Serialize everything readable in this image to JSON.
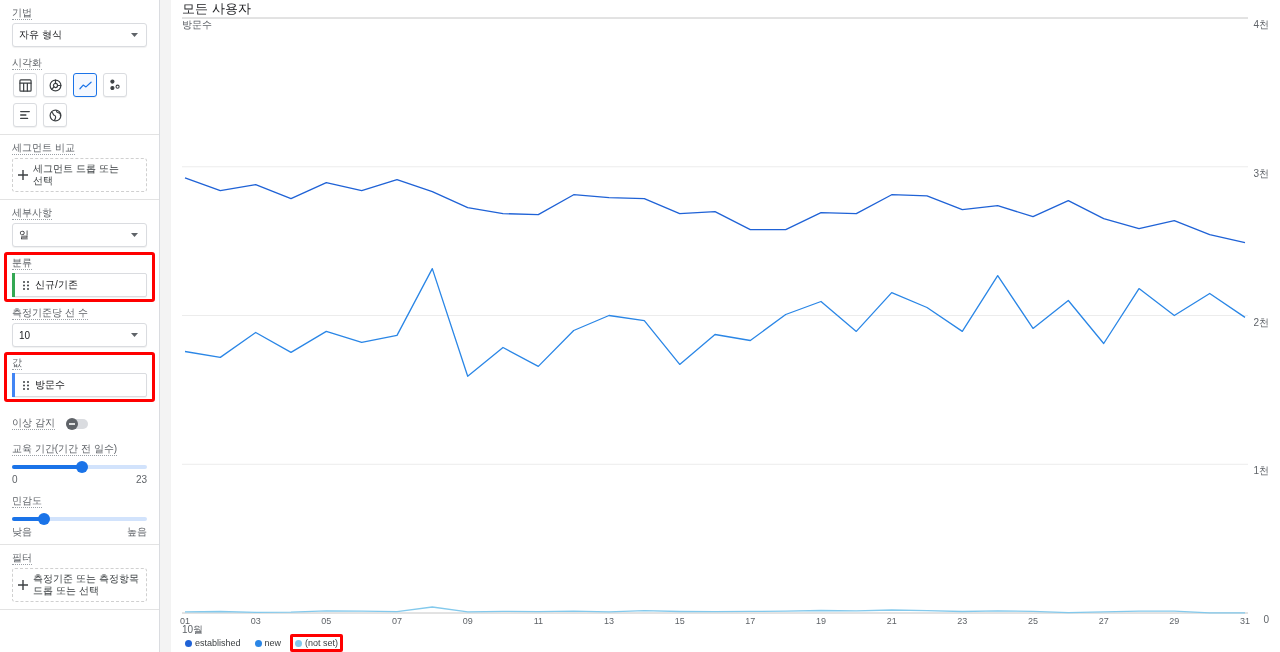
{
  "sidebar": {
    "groups": [
      {
        "fields": [
          {
            "kind": "dropdown",
            "label": "기법",
            "value": "자유 형식",
            "highlighted": false
          },
          {
            "kind": "visualizations",
            "label": "시각화",
            "highlighted": false,
            "options": [
              {
                "kind": "table",
                "selected": false
              },
              {
                "kind": "donut",
                "selected": false
              },
              {
                "kind": "line",
                "selected": true
              },
              {
                "kind": "scatter",
                "selected": false
              },
              {
                "kind": "bar",
                "selected": false
              },
              {
                "kind": "map",
                "selected": false
              }
            ]
          }
        ]
      },
      {
        "fields": [
          {
            "kind": "dropzone",
            "label": "세그먼트 비교",
            "text": "세그먼트 드롭 또는 선택",
            "highlighted": false
          }
        ]
      },
      {
        "fields": [
          {
            "kind": "dropdown",
            "label": "세부사항",
            "value": "일",
            "highlighted": false
          },
          {
            "kind": "chip",
            "label": "분류",
            "value": "신규/기존",
            "color": "#34a853",
            "highlighted": true
          },
          {
            "kind": "dropdown",
            "label": "측정기준당 선 수",
            "value": "10",
            "highlighted": false
          },
          {
            "kind": "chip",
            "label": "값",
            "value": "방문수",
            "color": "#4285f4",
            "highlighted": true
          },
          {
            "kind": "switch",
            "label": "이상 감지",
            "on": false,
            "highlighted": false
          },
          {
            "kind": "slider",
            "label": "교육 기간(기간 전 일수)",
            "level": 0.52,
            "min_label": "0",
            "max_label": "23",
            "highlighted": false
          },
          {
            "kind": "slider",
            "label": "민감도",
            "level": 0.24,
            "min_label": "낮음",
            "max_label": "높음",
            "highlighted": false
          }
        ]
      },
      {
        "fields": [
          {
            "kind": "dropzone",
            "label": "필터",
            "text": "측정기준 또는 측정항목 드롭 또는 선택",
            "highlighted": false
          }
        ]
      }
    ]
  },
  "chart": {
    "month_label": "10월",
    "chart_data": {
      "type": "line",
      "title": "모든 사용자",
      "ylabel": "방문수",
      "grid": true,
      "x": [
        1,
        2,
        3,
        4,
        5,
        6,
        7,
        8,
        9,
        10,
        11,
        12,
        13,
        14,
        15,
        16,
        17,
        18,
        19,
        20,
        21,
        22,
        23,
        24,
        25,
        26,
        27,
        28,
        29,
        30,
        31
      ],
      "xlim": [
        1,
        31
      ],
      "ylim": [
        0,
        4
      ],
      "yticks": [
        {
          "value": 0,
          "label": "0"
        },
        {
          "value": 1,
          "label": "1천"
        },
        {
          "value": 2,
          "label": "2천"
        },
        {
          "value": 3,
          "label": "3천"
        },
        {
          "value": 4,
          "label": "4천"
        }
      ],
      "xticks": [
        {
          "value": 1,
          "label": "01"
        },
        {
          "value": 3,
          "label": "03"
        },
        {
          "value": 5,
          "label": "05"
        },
        {
          "value": 7,
          "label": "07"
        },
        {
          "value": 9,
          "label": "09"
        },
        {
          "value": 11,
          "label": "11"
        },
        {
          "value": 13,
          "label": "13"
        },
        {
          "value": 15,
          "label": "15"
        },
        {
          "value": 17,
          "label": "17"
        },
        {
          "value": 19,
          "label": "19"
        },
        {
          "value": 21,
          "label": "21"
        },
        {
          "value": 23,
          "label": "23"
        },
        {
          "value": 25,
          "label": "25"
        },
        {
          "value": 27,
          "label": "27"
        },
        {
          "value": 29,
          "label": "29"
        },
        {
          "value": 31,
          "label": "31"
        }
      ],
      "series": [
        {
          "name": "established",
          "color": "#1f62d6",
          "values": [
            2.926,
            2.839,
            2.879,
            2.785,
            2.893,
            2.839,
            2.913,
            2.832,
            2.725,
            2.685,
            2.678,
            2.812,
            2.792,
            2.785,
            2.685,
            2.698,
            2.577,
            2.577,
            2.691,
            2.685,
            2.812,
            2.805,
            2.711,
            2.738,
            2.664,
            2.772,
            2.651,
            2.584,
            2.638,
            2.544,
            2.49
          ]
        },
        {
          "name": "new",
          "color": "#2a86e6",
          "values": [
            1.758,
            1.718,
            1.886,
            1.752,
            1.893,
            1.819,
            1.866,
            2.315,
            1.591,
            1.785,
            1.658,
            1.899,
            2.0,
            1.966,
            1.671,
            1.872,
            1.832,
            2.007,
            2.094,
            1.893,
            2.154,
            2.054,
            1.893,
            2.268,
            1.913,
            2.101,
            1.812,
            2.181,
            2.0,
            2.148,
            1.987
          ]
        },
        {
          "name": "(not set)",
          "color": "#83c9ec",
          "values": [
            0.008,
            0.01,
            0.005,
            0.006,
            0.014,
            0.012,
            0.009,
            0.04,
            0.008,
            0.011,
            0.009,
            0.013,
            0.008,
            0.016,
            0.01,
            0.009,
            0.011,
            0.012,
            0.017,
            0.015,
            0.02,
            0.016,
            0.01,
            0.014,
            0.011,
            0.002,
            0.008,
            0.012,
            0.012,
            0.001,
            0.001
          ]
        }
      ]
    },
    "legend": [
      {
        "highlighted": false
      },
      {
        "highlighted": false
      },
      {
        "highlighted": true
      }
    ]
  }
}
